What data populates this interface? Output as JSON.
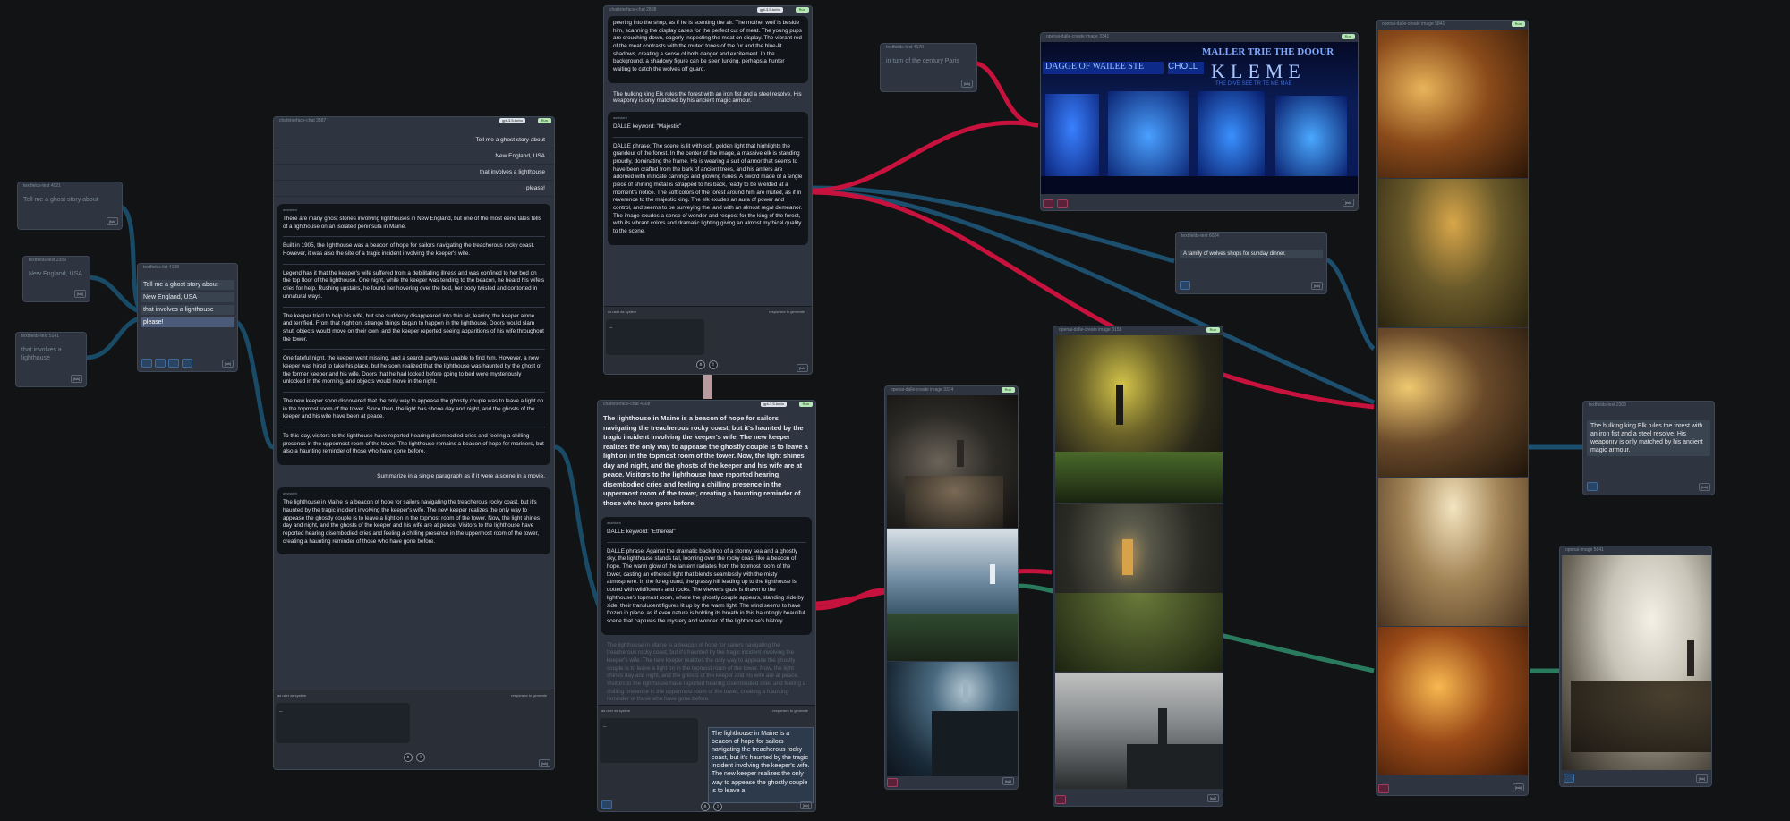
{
  "header_small": {
    "n1": "textfields-text 4921",
    "n2": "textfields-text 2359",
    "n3": "textfields-text 5141",
    "n4": "textfields-list 4108",
    "chat1": "chatinterface-chat 3587",
    "chat2": "chatinterface-chat 4308",
    "llm2": "chatinterface-chat 2808",
    "n5": "textfields-text 4170",
    "n6": "textfields-text 6024",
    "n7": "textfields-text 2308",
    "img1": "openai-dalle-create image 3341",
    "img2": "openai-dalle-create image 3374",
    "img3": "openai-dalle-create image 3158",
    "img4": "openai-dalle-create image 5841",
    "img5": "openai-dalle-create image 3322",
    "img6": "openai-image 5841"
  },
  "model": "gpt-3.5-turbo",
  "run": "Run",
  "token": "[tok]",
  "left": {
    "ghost": "Tell me a ghost story about",
    "ne": "New England, USA",
    "lh": "that involves a lighthouse"
  },
  "list": [
    "Tell me a ghost story about",
    "New England, USA",
    "that involves a lighthouse",
    "please!"
  ],
  "chat1": {
    "prompts": [
      "Tell me a ghost story about",
      "New England, USA",
      "that involves a lighthouse",
      "please!"
    ],
    "assistant_label": "assistant",
    "paras": [
      "There are many ghost stories involving lighthouses in New England, but one of the most eerie tales tells of a lighthouse on an isolated peninsula in Maine.",
      "Built in 1905, the lighthouse was a beacon of hope for sailors navigating the treacherous rocky coast. However, it was also the site of a tragic incident involving the keeper's wife.",
      "Legend has it that the keeper's wife suffered from a debilitating illness and was confined to her bed on the top floor of the lighthouse. One night, while the keeper was tending to the beacon, he heard his wife's cries for help. Rushing upstairs, he found her hovering over the bed, her body twisted and contorted in unnatural ways.",
      "The keeper tried to help his wife, but she suddenly disappeared into thin air, leaving the keeper alone and terrified. From that night on, strange things began to happen in the lighthouse. Doors would slam shut, objects would move on their own, and the keeper reported seeing apparitions of his wife throughout the tower.",
      "One fateful night, the keeper went missing, and a search party was unable to find him. However, a new keeper was hired to take his place, but he soon realized that the lighthouse was haunted by the ghost of the former keeper and his wife. Doors that he had locked before going to bed were mysteriously unlocked in the morning, and objects would move in the night.",
      "The new keeper soon discovered that the only way to appease the ghostly couple was to leave a light on in the topmost room of the tower. Since then, the light has shone day and night, and the ghosts of the keeper and his wife have been at peace.",
      "To this day, visitors to the lighthouse have reported hearing disembodied cries and feeling a chilling presence in the uppermost room of the tower. The lighthouse remains a beacon of hope for mariners, but also a haunting reminder of those who have gone before."
    ],
    "followup": "Summarize in a single paragraph as if it were a scene in a movie.",
    "summary": "The lighthouse in Maine is a beacon of hope for sailors navigating the treacherous rocky coast, but it's haunted by the tragic incident involving the keeper's wife. The new keeper realizes the only way to appease the ghostly couple is to leave a light on in the topmost room of the tower. Now, the light shines day and night, and the ghosts of the keeper and his wife are at peace. Visitors to the lighthouse have reported hearing disembodied cries and feeling a chilling presence in the uppermost room of the tower, creating a haunting reminder of those who have gone before.",
    "tabs": "as user   as system",
    "resp": "responses to generate",
    "caret": "_"
  },
  "chat2": {
    "top": "peering into the shop, as if he is scenting the air. The mother wolf is beside him, scanning the display cases for the perfect cut of meat. The young pups are crouching down, eagerly inspecting the meat on display. The vibrant red of the meat contrasts with the muted tones of the fur and the blue-lit shadows, creating a sense of both danger and excitement. In the background, a shadowy figure can be seen lurking, perhaps a hunter waiting to catch the wolves off guard.",
    "user": "The hulking king Elk rules the forest with an iron fist and a steel resolve. His weaponry is only matched by his ancient magic armour.",
    "keyword": "DALLE keyword: \"Majestic\"",
    "phrase": "DALLE phrase: The scene is lit with soft, golden light that highlights the grandeur of the forest. In the center of the image, a massive elk is standing proudly, dominating the frame. He is wearing a suit of armor that seems to have been crafted from the bark of ancient trees, and his antlers are adorned with intricate carvings and glowing runes. A sword made of a single piece of shining metal is strapped to his back, ready to be wielded at a moment's notice. The soft colors of the forest around him are muted, as if in reverence to the majestic king. The elk exudes an aura of power and control, and seems to be surveying the land with an almost regal demeanor. The image exudes a sense of wonder and respect for the king of the forest, with its vibrant colors and dramatic lighting giving an almost mythical quality to the scene."
  },
  "chat3": {
    "title": "The lighthouse in Maine is a beacon of hope for sailors navigating the treacherous rocky coast, but it's haunted by the tragic incident involving the keeper's wife. The new keeper realizes the only way to appease the ghostly couple is to leave a light on in the topmost room of the tower. Now, the light shines day and night, and the ghosts of the keeper and his wife are at peace. Visitors to the lighthouse have reported hearing disembodied cries and feeling a chilling presence in the uppermost room of the tower, creating a haunting reminder of those who have gone before.",
    "keyword": "DALLE keyword: \"Ethereal\"",
    "phrase": "DALLE phrase: Against the dramatic backdrop of a stormy sea and a ghostly sky, the lighthouse stands tall, looming over the rocky coast like a beacon of hope. The warm glow of the lantern radiates from the topmost room of the tower, casting an ethereal light that blends seamlessly with the misty atmosphere. In the foreground, the grassy hill leading up to the lighthouse is dotted with wildflowers and rocks. The viewer's gaze is drawn to the lighthouse's topmost room, where the ghostly couple appears, standing side by side, their translucent figures lit up by the warm light. The wind seems to have frozen in place, as if even nature is holding its breath in this hauntingly beautiful scene that captures the mystery and wonder of the lighthouse's history.",
    "faded": "The lighthouse in Maine is a beacon of hope for sailors navigating the treacherous rocky coast, but it's haunted by the tragic incident involving the keeper's wife. The new keeper realizes the only way to appease the ghostly couple is to leave a light on in the topmost room of the tower. Now, the light shines day and night, and the ghosts of the keeper and his wife are at peace. Visitors to the lighthouse have reported hearing disembodied cries and feeling a chilling presence in the uppermost room of the tower, creating a haunting reminder of those who have gone before.",
    "tooltip": "The lighthouse in Maine is a beacon of hope for sailors navigating the treacherous rocky coast, but it's haunted by the tragic incident involving the keeper's wife. The new keeper realizes the only way to appease the ghostly couple is to leave a"
  },
  "century": "in turn of the century Paris",
  "wolves": "A family of wolves shops for sunday dinner.",
  "elk": "The hulking king Elk rules the forest with an iron fist and a steel resolve. His weaponry is only matched by his ancient magic armour.",
  "shop_sign": {
    "a": "MALLER TRIE THE DOOUR",
    "b": "DAGGE OF WAILEE STE",
    "c": "KLEME",
    "d": "CHOLL",
    "e": "THE DIVE SEE TR TE ME MAE"
  },
  "colors": {
    "bg": "#121314",
    "node": "#2e3540",
    "wire_blue": "#1f5a7a",
    "wire_red": "#c8123e",
    "wire_green": "#2a7a5e"
  }
}
